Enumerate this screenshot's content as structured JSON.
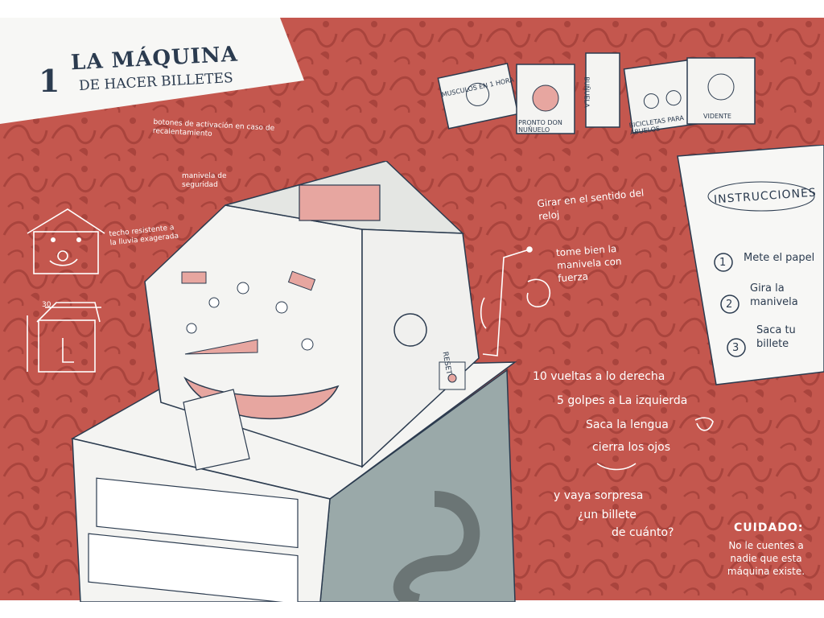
{
  "title": {
    "number": "1",
    "line1": "LA MÁQUINA",
    "line2": "DE HACER BILLETES"
  },
  "instructions": {
    "heading": "INSTRUCCIONES",
    "steps": [
      {
        "num": "1",
        "text": "Mete el papel"
      },
      {
        "num": "2",
        "text": "Gira la manivela"
      },
      {
        "num": "3",
        "text": "Saca tu billete"
      }
    ]
  },
  "annotations": {
    "buttons": "botones de activación en caso de recalentamiento",
    "crank": "manivela de seguridad",
    "roof": "techo resistente a la lluvia exagerada",
    "rotate": "Girar en el sentido del reloj",
    "grip": "tome bien la manivela con fuerza",
    "reset": "RESET",
    "dimension": "30"
  },
  "ritual": {
    "line1": "10 vueltas a lo derecha",
    "line2": "5 golpes a La izquierda",
    "line3": "Saca la lengua",
    "line4": "cierra los ojos",
    "line5": "y vaya sorpresa",
    "line6": "¿un billete",
    "line7": "de cuánto?"
  },
  "warning": {
    "heading": "CUIDADO:",
    "text": "No le cuentes a nadie que esta máquina existe."
  },
  "posters": [
    {
      "label": "MUSCULOS EN 1 HORA"
    },
    {
      "label": "PRONTO DON NUÑUELO"
    },
    {
      "label": "BUÑUELA"
    },
    {
      "label": "BICICLETAS PARA ABUELOS"
    },
    {
      "label": "VIDENTE"
    }
  ],
  "colors": {
    "background": "#c4574e",
    "pattern": "#a9443d",
    "ink": "#2b3b4f",
    "paper": "#f4f4f2",
    "tongue": "#e7a6a0",
    "cabinet": "#9aa9a9"
  }
}
